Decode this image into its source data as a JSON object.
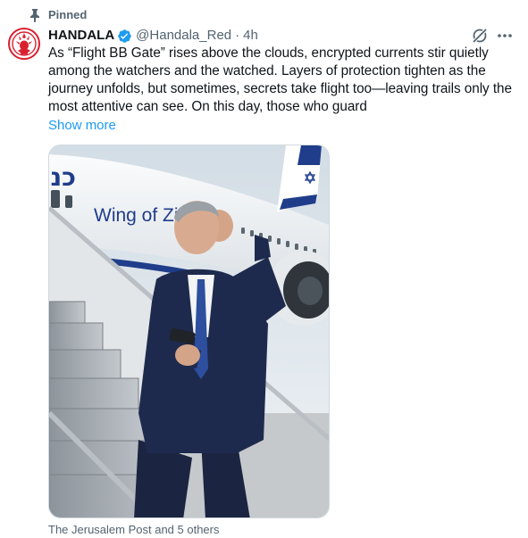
{
  "pinned": {
    "label": "Pinned",
    "icon": "pin-icon"
  },
  "author": {
    "display_name": "HANDALA",
    "verified": true,
    "handle": "@Handala_Red",
    "separator": "·",
    "time": "4h",
    "avatar_icon": "handala-logo"
  },
  "actions": {
    "grok_icon": "grok-icon",
    "more_icon": "more-icon"
  },
  "tweet": {
    "text": "As “Flight BB Gate” rises above the clouds, encrypted currents stir quietly among the watchers and the watched. Layers of protection tighten as the journey unfolds, but sometimes, secrets take flight too—leaving trails only the most attentive can see. On this day, those who guard",
    "show_more": "Show more"
  },
  "media": {
    "aircraft_text_hebrew": "כנף ציון",
    "aircraft_text_english": "Wing of Zion"
  },
  "caption": "The Jerusalem Post and 5 others",
  "colors": {
    "link": "#1d9bf0",
    "secondary": "#536471",
    "avatar_red": "#d9202f",
    "verified_blue": "#1d9bf0"
  }
}
